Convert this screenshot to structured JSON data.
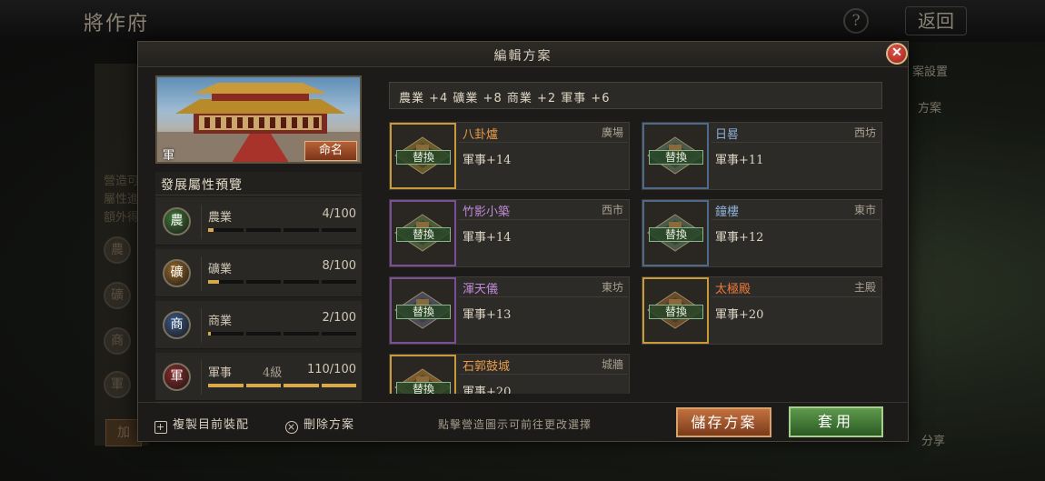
{
  "background": {
    "title": "將作府",
    "help_label": "?",
    "back_label": "返回",
    "side_text_1": "營造可",
    "side_text_2": "屬性進",
    "side_text_3": "額外得",
    "side_circles": [
      "農",
      "礦",
      "商",
      "軍"
    ],
    "right_text_1": "案設置",
    "right_text_2": "方案",
    "right_text_3": "分享",
    "bottom_button": "加"
  },
  "dialog": {
    "title": "編輯方案",
    "close_label": "✕",
    "preview": {
      "label": "軍",
      "rename_button": "命名"
    },
    "attributes": {
      "heading": "發展屬性預覽",
      "items": [
        {
          "icon": "農",
          "name": "農業",
          "level": "",
          "value": "4/100",
          "progress": 0.04,
          "color": "#3f7a3a"
        },
        {
          "icon": "礦",
          "name": "礦業",
          "level": "",
          "value": "8/100",
          "progress": 0.08,
          "color": "#9a6a2a"
        },
        {
          "icon": "商",
          "name": "商業",
          "level": "",
          "value": "2/100",
          "progress": 0.02,
          "color": "#3a5a8a"
        },
        {
          "icon": "軍",
          "name": "軍事",
          "level": "4級",
          "value": "110/100",
          "progress": 1.0,
          "color": "#8a2a2a"
        }
      ]
    },
    "summary": "農業 +4   礦業 +8   商業 +2   軍事 +6",
    "replace_label": "替換",
    "buildings": [
      {
        "name": "八卦爐",
        "location": "廣場",
        "bonus": "軍事+14",
        "name_class": "name-orange",
        "frame": "gold",
        "tile_color": "#6a5a2a"
      },
      {
        "name": "日晷",
        "location": "西坊",
        "bonus": "軍事+11",
        "name_class": "name-blue",
        "frame": "blue",
        "tile_color": "#4a5a4a"
      },
      {
        "name": "竹影小築",
        "location": "西市",
        "bonus": "軍事+14",
        "name_class": "name-purple",
        "frame": "purple",
        "tile_color": "#4a5a3a"
      },
      {
        "name": "鐘樓",
        "location": "東市",
        "bonus": "軍事+12",
        "name_class": "name-blue",
        "frame": "blue",
        "tile_color": "#4a5a4a"
      },
      {
        "name": "渾天儀",
        "location": "東坊",
        "bonus": "軍事+13",
        "name_class": "name-purple",
        "frame": "purple",
        "tile_color": "#4a4a5a"
      },
      {
        "name": "太極殿",
        "location": "主殿",
        "bonus": "軍事+20",
        "name_class": "name-red",
        "frame": "gold",
        "tile_color": "#6a4a2a"
      },
      {
        "name": "石郭鼓城",
        "location": "城牆",
        "bonus": "軍事+20",
        "name_class": "name-orange",
        "frame": "gold",
        "tile_color": "#7a5a2a"
      }
    ],
    "footer": {
      "copy_label": "複製目前裝配",
      "delete_label": "刪除方案",
      "hint": "點擊營造圖示可前往更改選擇",
      "save_button": "儲存方案",
      "apply_button": "套用"
    }
  }
}
